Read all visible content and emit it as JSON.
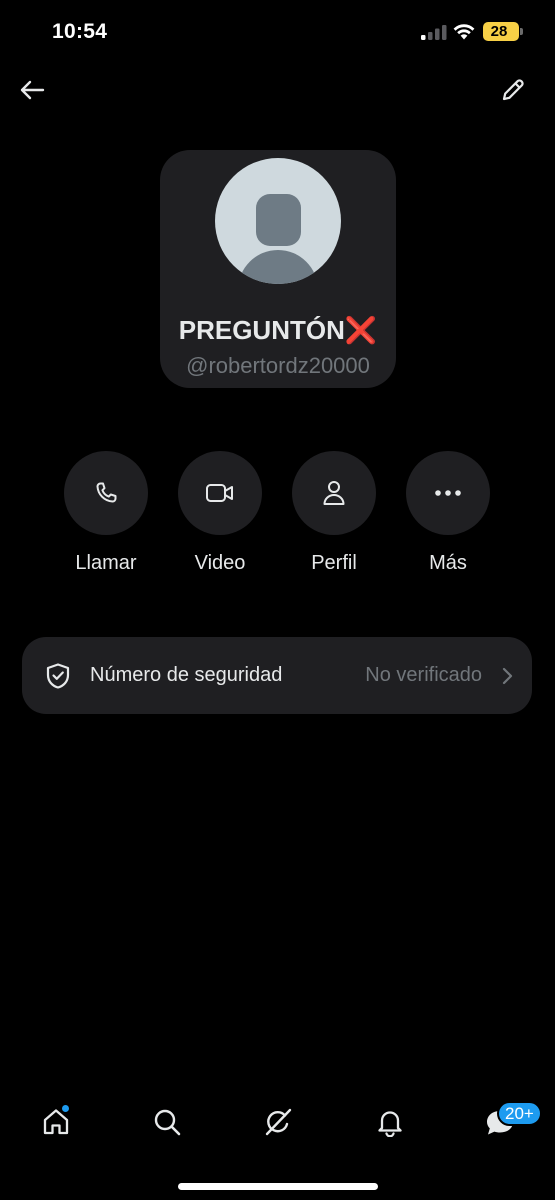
{
  "status_bar": {
    "time": "10:54",
    "battery": "28"
  },
  "header": {
    "back_icon": "arrow-left-icon",
    "edit_icon": "pencil-icon"
  },
  "profile": {
    "name": "PREGUNTÓN❌",
    "handle": "@robertordz20000",
    "avatar_icon": "default-avatar"
  },
  "actions": [
    {
      "label": "Llamar",
      "icon": "phone-icon"
    },
    {
      "label": "Video",
      "icon": "video-camera-icon"
    },
    {
      "label": "Perfil",
      "icon": "person-icon"
    },
    {
      "label": "Más",
      "icon": "more-dots-icon"
    }
  ],
  "security": {
    "label": "Número de seguridad",
    "status": "No verificado",
    "icon": "shield-check-icon"
  },
  "bottom_nav": {
    "items": [
      "home-icon",
      "search-icon",
      "grok-icon",
      "notifications-bell-icon",
      "messages-icon"
    ],
    "messages_badge": "20+"
  },
  "colors": {
    "background": "#000000",
    "card": "#1f1f22",
    "accent": "#1d9bf0",
    "muted_text": "#71767b",
    "battery": "#f7d046"
  }
}
